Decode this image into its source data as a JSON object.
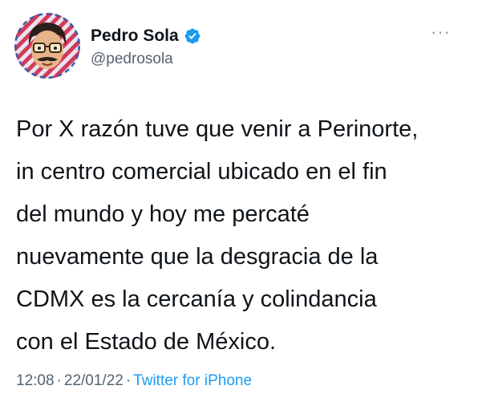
{
  "author": {
    "name": "Pedro Sola",
    "handle": "@pedrosola",
    "verified": true,
    "avatar_icon": "cartoon-face-avatar"
  },
  "more_label": "···",
  "tweet": {
    "text": "Por X razón tuve que venir a Perinorte,\nin centro comercial ubicado en el fin\ndel mundo y hoy me percaté\nnuevamente que la desgracia de la\nCDMX es la cercanía y colindancia\ncon el Estado de México."
  },
  "meta": {
    "time": "12:08",
    "separator": "·",
    "date": "22/01/22",
    "source": "Twitter for iPhone"
  },
  "colors": {
    "text": "#0f1419",
    "secondary": "#536471",
    "link": "#1d9bf0",
    "verified": "#1d9bf0"
  }
}
